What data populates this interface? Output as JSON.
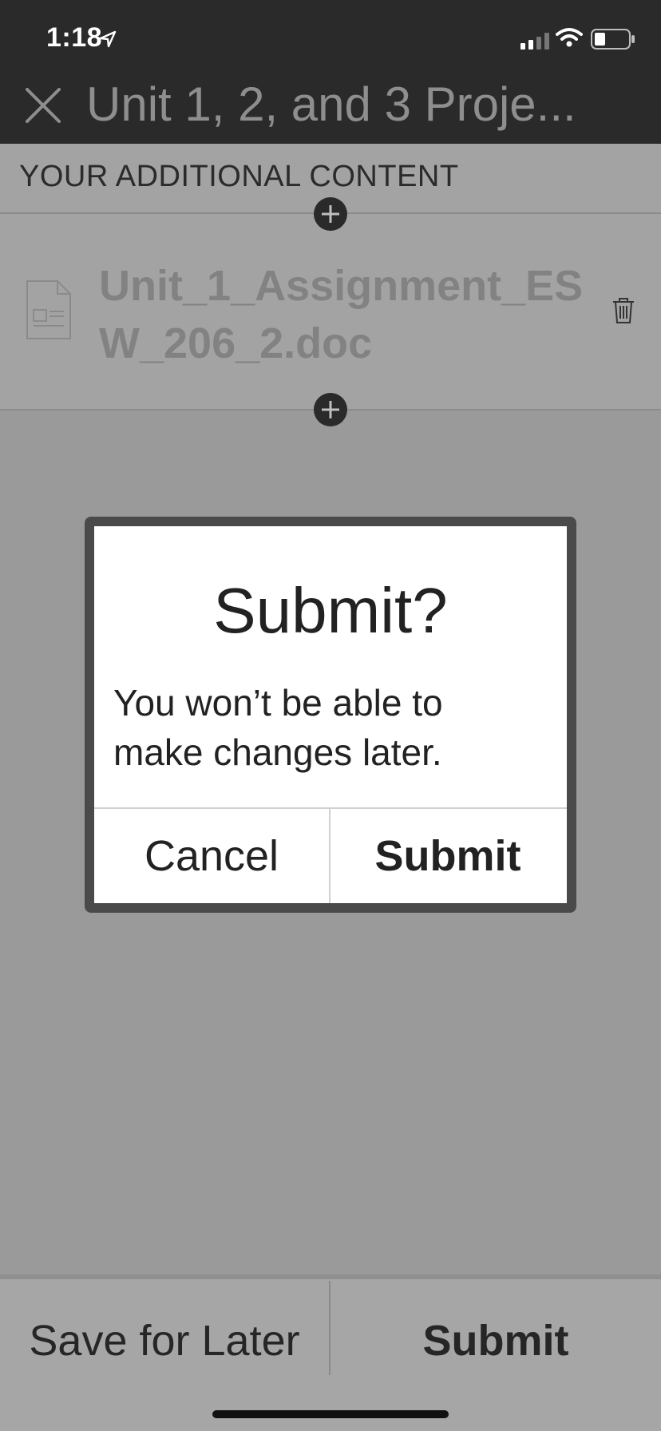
{
  "status_bar": {
    "time": "1:18"
  },
  "header": {
    "title": "Unit 1, 2, and 3 Proje..."
  },
  "content": {
    "section_label": "YOUR ADDITIONAL CONTENT",
    "file_name": "Unit_1_Assignment_ESW_206_2.doc"
  },
  "dialog": {
    "title": "Submit?",
    "message": "You won’t be able to make changes later.",
    "cancel_label": "Cancel",
    "submit_label": "Submit"
  },
  "footer": {
    "save_label": "Save for Later",
    "submit_label": "Submit"
  }
}
